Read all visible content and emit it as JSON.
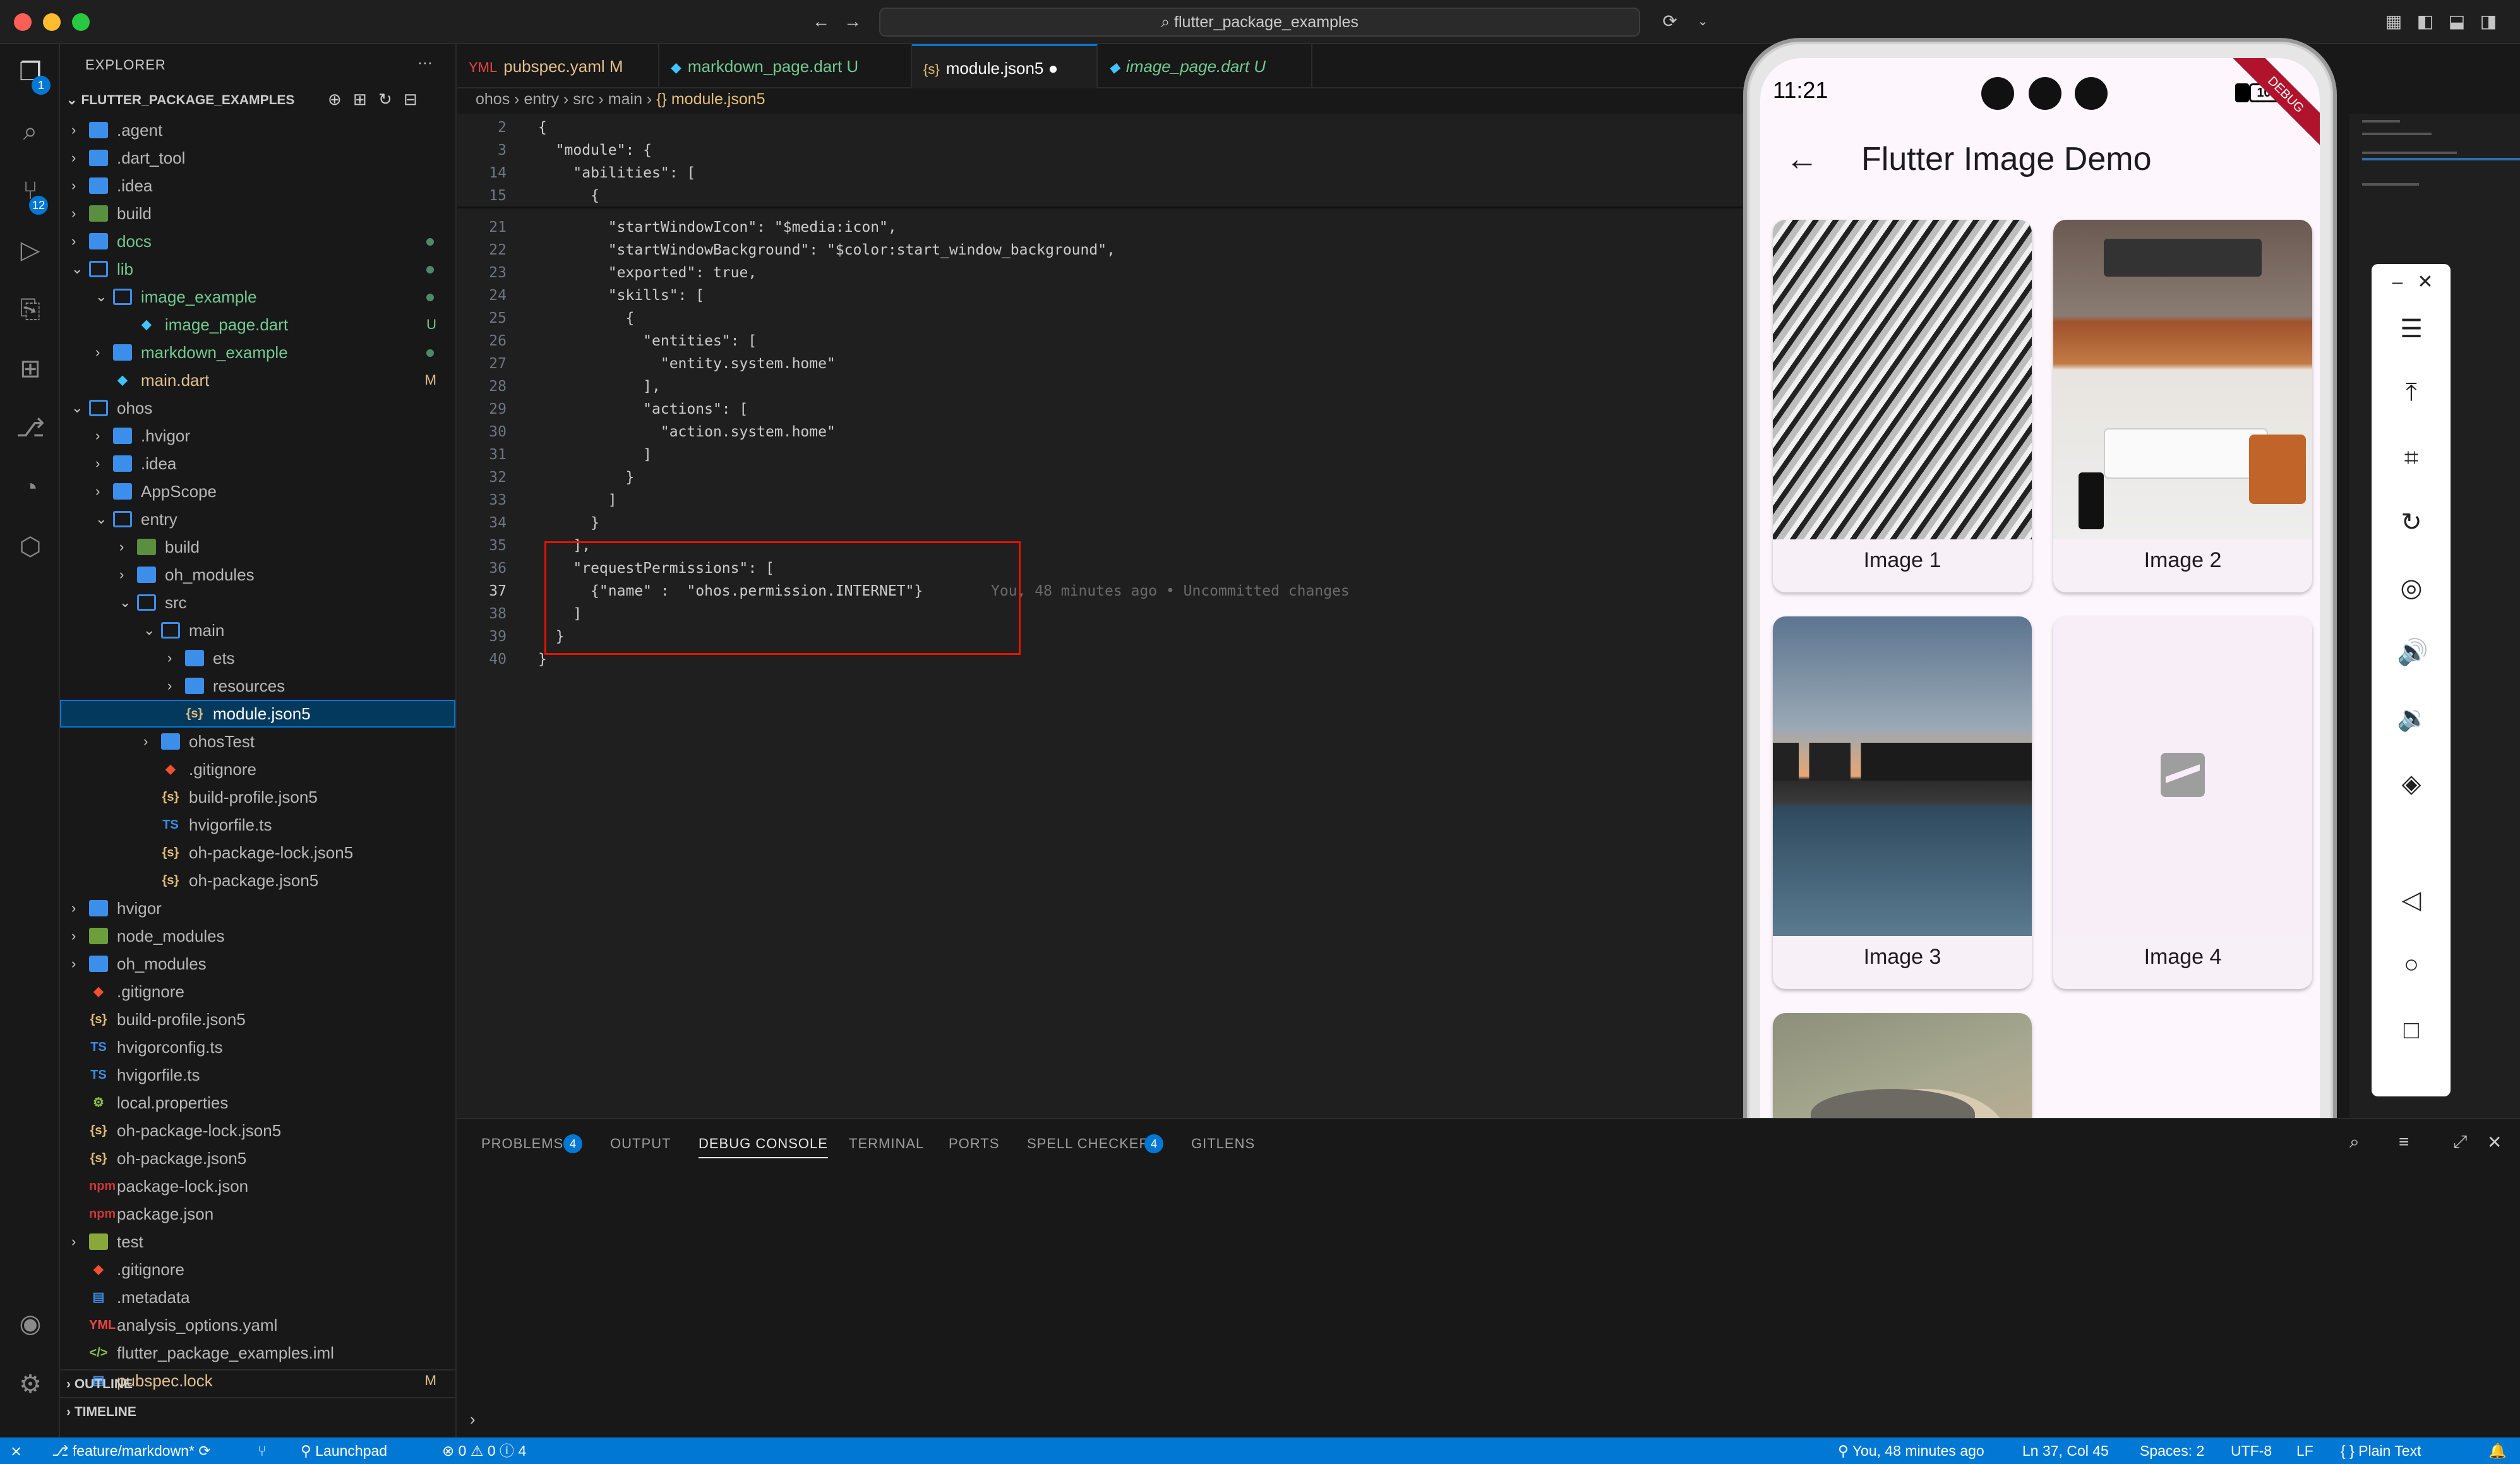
{
  "titlebar": {
    "search": "flutter_package_examples",
    "colors": {
      "close": "#ff5f57",
      "minimize": "#febc2e",
      "zoom": "#28c840"
    }
  },
  "activity": {
    "explorer_badge": "1",
    "scm_badge": "12"
  },
  "sidebar": {
    "header": "EXPLORER",
    "more": "···",
    "workspace": "FLUTTER_PACKAGE_EXAMPLES",
    "tree": [
      {
        "label": ".agent",
        "chev": "›",
        "status": ""
      },
      {
        "label": ".dart_tool",
        "chev": "›",
        "status": ""
      },
      {
        "label": ".idea",
        "chev": "›",
        "status": ""
      },
      {
        "label": "build",
        "chev": "›",
        "status": ""
      },
      {
        "label": "docs",
        "chev": "›",
        "status": ""
      },
      {
        "label": "lib",
        "chev": "⌄",
        "status": ""
      },
      {
        "label": "image_example",
        "chev": "⌄",
        "status": ""
      },
      {
        "label": "image_page.dart",
        "chev": "",
        "status": "U"
      },
      {
        "label": "markdown_example",
        "chev": "›",
        "status": ""
      },
      {
        "label": "main.dart",
        "chev": "",
        "status": "M"
      },
      {
        "label": "ohos",
        "chev": "⌄",
        "status": ""
      },
      {
        "label": ".hvigor",
        "chev": "›",
        "status": ""
      },
      {
        "label": ".idea",
        "chev": "›",
        "status": ""
      },
      {
        "label": "AppScope",
        "chev": "›",
        "status": ""
      },
      {
        "label": "entry",
        "chev": "⌄",
        "status": ""
      },
      {
        "label": "build",
        "chev": "›",
        "status": ""
      },
      {
        "label": "oh_modules",
        "chev": "›",
        "status": ""
      },
      {
        "label": "src",
        "chev": "⌄",
        "status": ""
      },
      {
        "label": "main",
        "chev": "⌄",
        "status": ""
      },
      {
        "label": "ets",
        "chev": "›",
        "status": ""
      },
      {
        "label": "resources",
        "chev": "›",
        "status": ""
      },
      {
        "label": "module.json5",
        "chev": "",
        "status": ""
      },
      {
        "label": "ohosTest",
        "chev": "›",
        "status": ""
      },
      {
        "label": ".gitignore",
        "chev": "",
        "status": ""
      },
      {
        "label": "build-profile.json5",
        "chev": "",
        "status": ""
      },
      {
        "label": "hvigorfile.ts",
        "chev": "",
        "status": ""
      },
      {
        "label": "oh-package-lock.json5",
        "chev": "",
        "status": ""
      },
      {
        "label": "oh-package.json5",
        "chev": "",
        "status": ""
      },
      {
        "label": "hvigor",
        "chev": "›",
        "status": ""
      },
      {
        "label": "node_modules",
        "chev": "›",
        "status": ""
      },
      {
        "label": "oh_modules",
        "chev": "›",
        "status": ""
      },
      {
        "label": ".gitignore",
        "chev": "",
        "status": ""
      },
      {
        "label": "build-profile.json5",
        "chev": "",
        "status": ""
      },
      {
        "label": "hvigorconfig.ts",
        "chev": "",
        "status": ""
      },
      {
        "label": "hvigorfile.ts",
        "chev": "",
        "status": ""
      },
      {
        "label": "local.properties",
        "chev": "",
        "status": ""
      },
      {
        "label": "oh-package-lock.json5",
        "chev": "",
        "status": ""
      },
      {
        "label": "oh-package.json5",
        "chev": "",
        "status": ""
      },
      {
        "label": "package-lock.json",
        "chev": "",
        "status": ""
      },
      {
        "label": "package.json",
        "chev": "",
        "status": ""
      },
      {
        "label": "test",
        "chev": "›",
        "status": ""
      },
      {
        "label": ".gitignore",
        "chev": "",
        "status": ""
      },
      {
        "label": ".metadata",
        "chev": "",
        "status": ""
      },
      {
        "label": "analysis_options.yaml",
        "chev": "",
        "status": ""
      },
      {
        "label": "flutter_package_examples.iml",
        "chev": "",
        "status": ""
      },
      {
        "label": "pubspec.lock",
        "chev": "",
        "status": "M"
      }
    ],
    "outline": "OUTLINE",
    "timeline": "TIMELINE"
  },
  "tabs": [
    {
      "label": "pubspec.yaml",
      "status": "M",
      "icon": "yaml-icon"
    },
    {
      "label": "markdown_page.dart",
      "status": "U",
      "icon": "dart-icon"
    },
    {
      "label": "module.json5",
      "status": "●",
      "icon": "json-icon"
    },
    {
      "label": "image_page.dart",
      "status": "U",
      "icon": "dart-icon"
    }
  ],
  "breadcrumb": [
    "ohos",
    "entry",
    "src",
    "main",
    "{} module.json5"
  ],
  "code": [
    {
      "n": "2",
      "text": "{"
    },
    {
      "n": "3",
      "text": "  \"module\": {"
    },
    {
      "n": "14",
      "text": "    \"abilities\": ["
    },
    {
      "n": "15",
      "text": "      {"
    },
    {
      "n": "21",
      "text": "        \"startWindowIcon\": \"$media:icon\","
    },
    {
      "n": "22",
      "text": "        \"startWindowBackground\": \"$color:start_window_background\","
    },
    {
      "n": "23",
      "text": "        \"exported\": true,"
    },
    {
      "n": "24",
      "text": "        \"skills\": ["
    },
    {
      "n": "25",
      "text": "          {"
    },
    {
      "n": "26",
      "text": "            \"entities\": ["
    },
    {
      "n": "27",
      "text": "              \"entity.system.home\""
    },
    {
      "n": "28",
      "text": "            ],"
    },
    {
      "n": "29",
      "text": "            \"actions\": ["
    },
    {
      "n": "30",
      "text": "              \"action.system.home\""
    },
    {
      "n": "31",
      "text": "            ]"
    },
    {
      "n": "32",
      "text": "          }"
    },
    {
      "n": "33",
      "text": "        ]"
    },
    {
      "n": "34",
      "text": "      }"
    },
    {
      "n": "35",
      "text": "    ],"
    },
    {
      "n": "36",
      "text": "    \"requestPermissions\": ["
    },
    {
      "n": "37",
      "text": "      {\"name\" :  \"ohos.permission.INTERNET\"}"
    },
    {
      "n": "38",
      "text": "    ]"
    },
    {
      "n": "39",
      "text": "  }"
    },
    {
      "n": "40",
      "text": "}"
    }
  ],
  "blame": "You, 48 minutes ago • Uncommitted changes",
  "panel": {
    "tabs": [
      "PROBLEMS",
      "OUTPUT",
      "DEBUG CONSOLE",
      "TERMINAL",
      "PORTS",
      "SPELL CHECKER",
      "GITLENS"
    ],
    "problems_badge": "4",
    "spell_badge": "4",
    "prompt": "›"
  },
  "statusbar": {
    "branch": "feature/markdown*",
    "launchpad": "Launchpad",
    "errors": "0",
    "warnings": "0",
    "info": "4",
    "blame": "You, 48 minutes ago",
    "position": "Ln 37, Col 45",
    "spaces": "Spaces: 2",
    "encoding": "UTF-8",
    "eol": "LF",
    "language": "Plain Text"
  },
  "phone": {
    "clock": "11:21",
    "battery": "100",
    "debug": "DEBUG",
    "title": "Flutter Image Demo",
    "cards": [
      {
        "caption": "Image 1"
      },
      {
        "caption": "Image 2"
      },
      {
        "caption": "Image 3"
      },
      {
        "caption": "Image 4"
      }
    ]
  }
}
